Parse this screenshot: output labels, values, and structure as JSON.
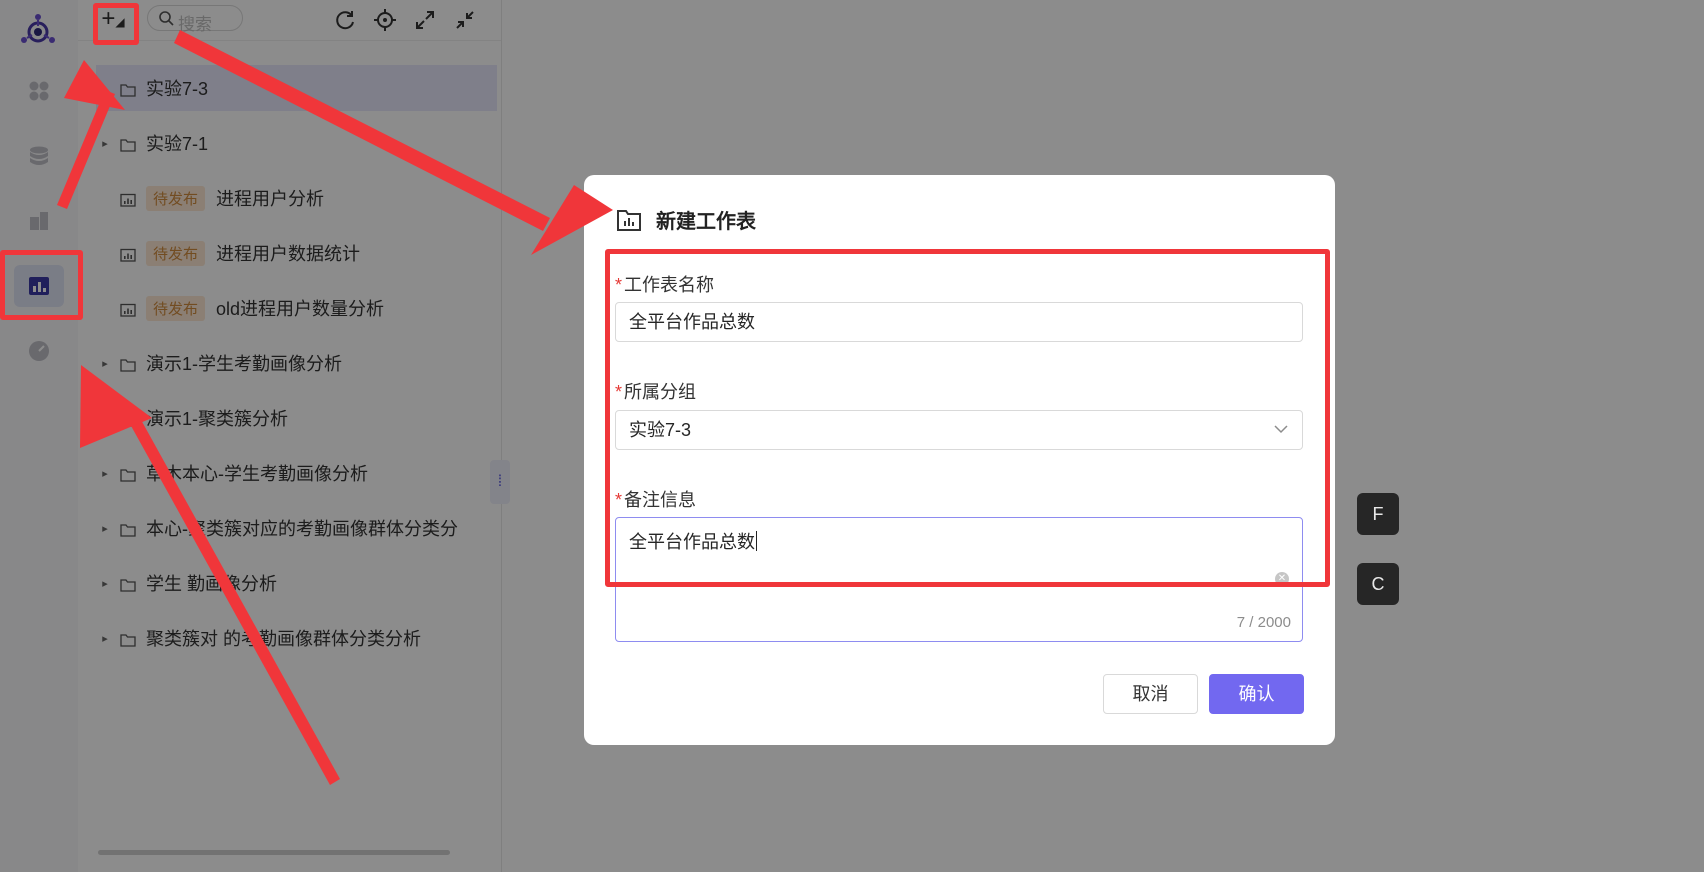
{
  "rail": {
    "items": [
      {
        "icon": "app-grid-icon"
      },
      {
        "icon": "database-icon"
      },
      {
        "icon": "dataset-icon"
      },
      {
        "icon": "worksheet-icon",
        "active": true
      },
      {
        "icon": "dashboard-icon"
      }
    ]
  },
  "toolbar": {
    "add_label": "+",
    "search_placeholder": "搜索",
    "icons": [
      "refresh-icon",
      "locate-icon",
      "expand-icon",
      "collapse-icon"
    ]
  },
  "tree": {
    "nodes": [
      {
        "label": "实验7-3",
        "type": "folder",
        "selected": true
      },
      {
        "label": "实验7-1",
        "type": "folder",
        "expandable": true
      },
      {
        "label": "进程用户分析",
        "type": "sheet",
        "badge": "待发布"
      },
      {
        "label": "进程用户数据统计",
        "type": "sheet",
        "badge": "待发布"
      },
      {
        "label": "old进程用户数量分析",
        "type": "sheet",
        "badge": "待发布"
      },
      {
        "label": "演示1-学生考勤画像分析",
        "type": "folder",
        "expandable": true
      },
      {
        "label": "演示1-聚类簇分析",
        "type": "folder"
      },
      {
        "label": "草木本心-学生考勤画像分析",
        "type": "folder",
        "expandable": true
      },
      {
        "label": "本心-聚类簇对应的考勤画像群体分类分",
        "type": "folder",
        "expandable": true
      },
      {
        "label": "学生 勤画像分析",
        "type": "folder",
        "expandable": true
      },
      {
        "label": "聚类簇对 的考勤画像群体分类分析",
        "type": "folder",
        "expandable": true
      }
    ]
  },
  "modal": {
    "title": "新建工作表",
    "required_mark": "*",
    "name_label": "工作表名称",
    "name_value": "全平台作品总数",
    "group_label": "所属分组",
    "group_value": "实验7-3",
    "note_label": "备注信息",
    "note_value": "全平台作品总数",
    "note_count": "7 / 2000",
    "cancel_label": "取消",
    "confirm_label": "确认"
  },
  "floating": {
    "key_f": "F",
    "key_c": "C"
  },
  "colors": {
    "primary": "#7268f0",
    "annotation": "#f0363a",
    "badge_bg": "#fde8d4",
    "badge_text": "#d08a3c"
  }
}
